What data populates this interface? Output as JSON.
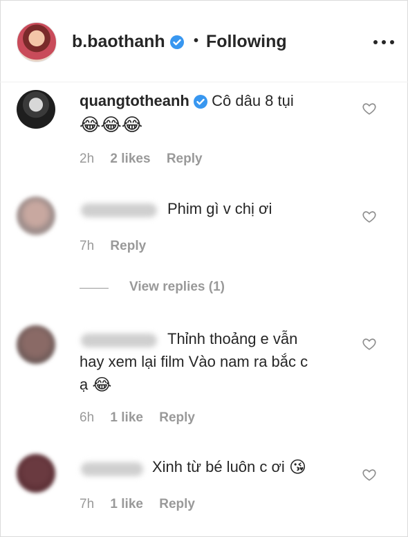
{
  "header": {
    "username": "b.baothanh",
    "separator": "•",
    "follow_status": "Following"
  },
  "comments": [
    {
      "username": "quangtotheanh",
      "verified": true,
      "text": "Cô dâu 8 tụi",
      "emoji": "😂😂😂",
      "time": "2h",
      "likes": "2 likes",
      "reply": "Reply"
    },
    {
      "username": "",
      "text": "Phim gì v chị ơi",
      "time": "7h",
      "likes": "",
      "reply": "Reply",
      "view_replies": "View replies (1)"
    },
    {
      "username": "",
      "text_line1": "Thỉnh thoảng e vẫn",
      "text_line2": "hay xem lại film Vào nam ra bắc c",
      "text_line3": "ạ",
      "emoji": "😂",
      "time": "6h",
      "likes": "1 like",
      "reply": "Reply"
    },
    {
      "username": "",
      "text": "Xinh từ bé luôn c ơi",
      "emoji": "😘",
      "time": "7h",
      "likes": "1 like",
      "reply": "Reply"
    }
  ],
  "icons": {
    "verified": "verified-badge-icon",
    "more": "more-options-icon",
    "like": "heart-outline-icon"
  },
  "colors": {
    "verified_blue": "#3897f0",
    "meta_gray": "#999999",
    "text": "#262626"
  }
}
